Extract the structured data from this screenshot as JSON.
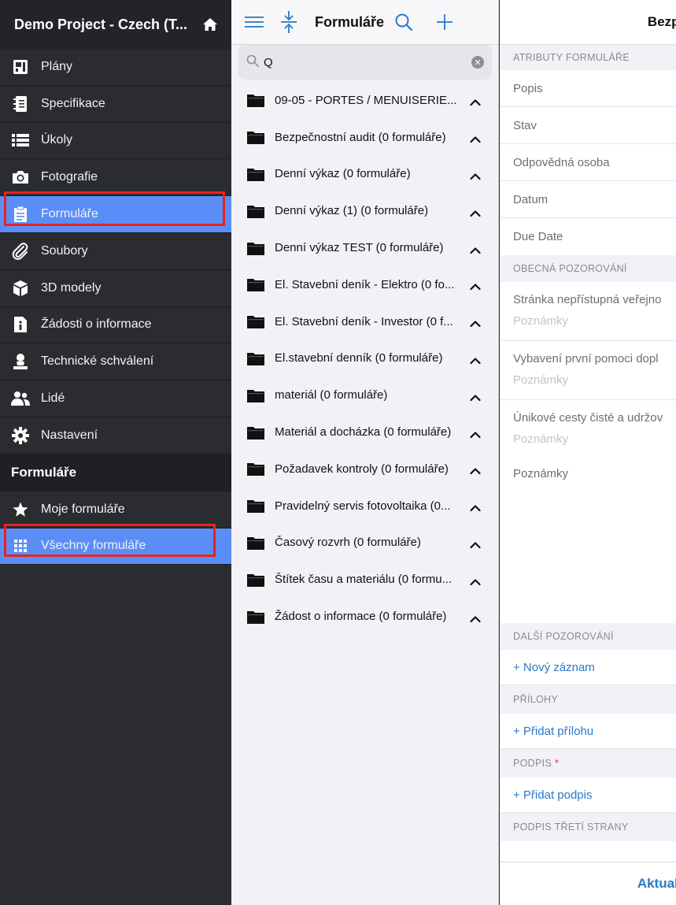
{
  "sidebar": {
    "project_title": "Demo Project - Czech (T...",
    "items": [
      {
        "label": "Plány",
        "icon": "blueprint-icon"
      },
      {
        "label": "Specifikace",
        "icon": "notebook-icon"
      },
      {
        "label": "Úkoly",
        "icon": "list-icon"
      },
      {
        "label": "Fotografie",
        "icon": "camera-icon"
      },
      {
        "label": "Formuláře",
        "icon": "clipboard-icon",
        "active": true
      },
      {
        "label": "Soubory",
        "icon": "paperclip-icon"
      },
      {
        "label": "3D modely",
        "icon": "cube-icon"
      },
      {
        "label": "Žádosti o informace",
        "icon": "info-document-icon"
      },
      {
        "label": "Technické schválení",
        "icon": "approval-person-icon"
      },
      {
        "label": "Lidé",
        "icon": "people-icon"
      },
      {
        "label": "Nastavení",
        "icon": "gear-icon"
      }
    ],
    "section_title": "Formuláře",
    "forms_items": [
      {
        "label": "Moje formuláře",
        "icon": "star-icon"
      },
      {
        "label": "Všechny formuláře",
        "icon": "grid-icon",
        "active": true
      }
    ],
    "accent_color": "#5b8df7",
    "highlight_color": "#e8231b"
  },
  "middle": {
    "title": "Formuláře",
    "search_value": "Q",
    "folders": [
      "09-05 - PORTES / MENUISERIE...",
      "Bezpečnostní audit (0 formuláře)",
      "Denní výkaz (0 formuláře)",
      "Denní výkaz (1) (0 formuláře)",
      "Denní výkaz TEST (0 formuláře)",
      "El. Stavební deník - Elektro (0 fo...",
      "El. Stavební deník - Investor (0 f...",
      "El.stavební denník (0 formuláře)",
      "materiál (0 formuláře)",
      "Materiál a docházka (0 formuláře)",
      "Požadavek kontroly (0 formuláře)",
      "Pravidelný servis fotovoltaika (0...",
      "Časový rozvrh (0 formuláře)",
      "Štítek času a materiálu (0 formu...",
      "Žádost o informace (0 formuláře)"
    ]
  },
  "right": {
    "header_title": "Bezpe",
    "section_attributes": "ATRIBUTY FORMULÁŘE",
    "attributes": [
      "Popis",
      "Stav",
      "Odpovědná osoba",
      "Datum",
      "Due Date"
    ],
    "section_general": "OBECNÁ POZOROVÁNÍ",
    "observations": [
      {
        "text": "Stránka nepřístupná veřejno",
        "note": "Poznámky"
      },
      {
        "text": "Vybavení první pomoci dopl",
        "note": "Poznámky"
      },
      {
        "text": "Únikové cesty čisté a udržov",
        "note": "Poznámky"
      }
    ],
    "notes_label": "Poznámky",
    "section_more": "DALŠÍ POZOROVÁNÍ",
    "new_record": "+ Nový záznam",
    "section_attachments": "PŘÍLOHY",
    "add_attachment": "+ Přidat přílohu",
    "section_signature": "PODPIS",
    "required_mark": "*",
    "add_signature": "+ Přidat podpis",
    "section_third_party": "PODPIS TŘETÍ STRANY",
    "bottom_button": "Aktualiz"
  }
}
